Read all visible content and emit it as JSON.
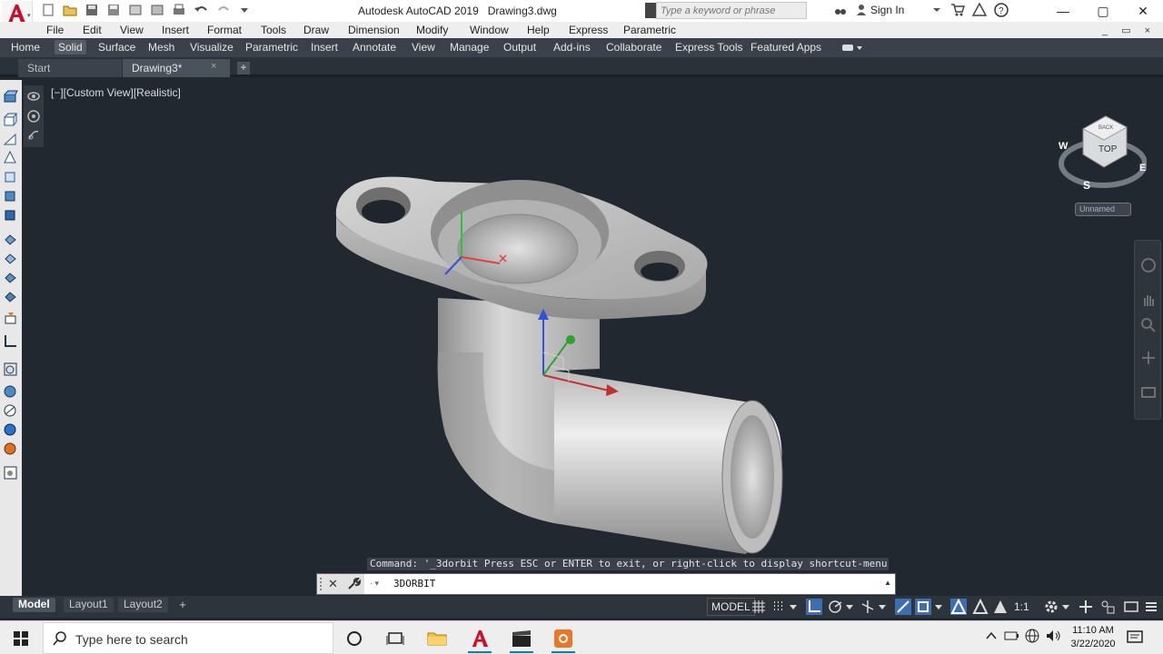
{
  "window": {
    "app_name": "Autodesk AutoCAD 2019",
    "file_name": "Drawing3.dwg",
    "search_placeholder": "Type a keyword or phrase",
    "sign_in": "Sign In"
  },
  "menubar": {
    "items": [
      "File",
      "Edit",
      "View",
      "Insert",
      "Format",
      "Tools",
      "Draw",
      "Dimension",
      "Modify",
      "Window",
      "Help",
      "Express",
      "Parametric"
    ],
    "right_controls": "_ ▭ ×"
  },
  "ribbon": {
    "tabs": [
      "Home",
      "Solid",
      "Surface",
      "Mesh",
      "Visualize",
      "Parametric",
      "Insert",
      "Annotate",
      "View",
      "Manage",
      "Output",
      "Add-ins",
      "Collaborate",
      "Express Tools",
      "Featured Apps"
    ],
    "active_tab": "Solid"
  },
  "doc_tabs": {
    "start": "Start",
    "active": "Drawing3*",
    "close": "×",
    "add": "+"
  },
  "viewport": {
    "label": "[−][Custom View][Realistic]",
    "viewcube_face": "TOP",
    "viewcube_back": "BACK",
    "compass": {
      "n": "",
      "w": "W",
      "e": "E",
      "s": "S"
    },
    "ucs_name": "Unnamed"
  },
  "command": {
    "history": "Command: '_3dorbit Press ESC or ENTER to exit, or right-click to display shortcut-menu.",
    "input_value": "3DORBIT",
    "close": "✕",
    "prompt_icon": "· ▾",
    "expand": "▲"
  },
  "layout_tabs": [
    "Model",
    "Layout1",
    "Layout2"
  ],
  "layout_add": "+",
  "status": {
    "model": "MODEL",
    "scale": "1:1"
  },
  "taskbar": {
    "search_text": "Type here to search",
    "time": "11:10 AM",
    "date": "3/22/2020"
  },
  "colors": {
    "viewport_bg": "#212830",
    "ribbon_bg": "#3a414a",
    "accent_blue": "#3e6eb0",
    "logo_red": "#c8102e"
  }
}
